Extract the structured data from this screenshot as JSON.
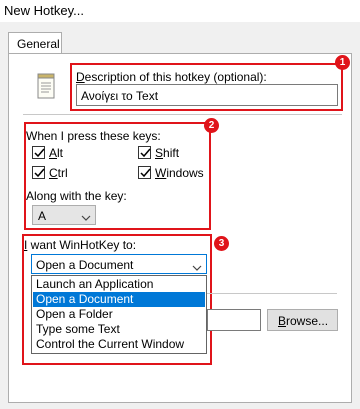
{
  "window": {
    "title": "New Hotkey..."
  },
  "tabs": [
    {
      "label": "General"
    }
  ],
  "description": {
    "label": "Description of this hotkey (optional):",
    "value": "Ανοίγει το Text",
    "badge": "1"
  },
  "keys": {
    "label": "When I press these keys:",
    "badge": "2",
    "modifiers": [
      {
        "label": "Alt",
        "checked": true
      },
      {
        "label": "Shift",
        "checked": true
      },
      {
        "label": "Ctrl",
        "checked": true
      },
      {
        "label": "Windows",
        "checked": true
      }
    ],
    "along_label": "Along with the key:",
    "key_value": "A"
  },
  "action": {
    "label": "I want WinHotKey to:",
    "badge": "3",
    "selected": "Open a Document",
    "options": [
      "Launch an Application",
      "Open a Document",
      "Open a Folder",
      "Type some Text",
      "Control the Current Window"
    ],
    "browse_label": "Browse..."
  },
  "colors": {
    "accent": "#e0141a",
    "selection": "#0078d7"
  },
  "icons": {
    "note": "notepad-icon",
    "chevron": "chevron-down-icon"
  }
}
